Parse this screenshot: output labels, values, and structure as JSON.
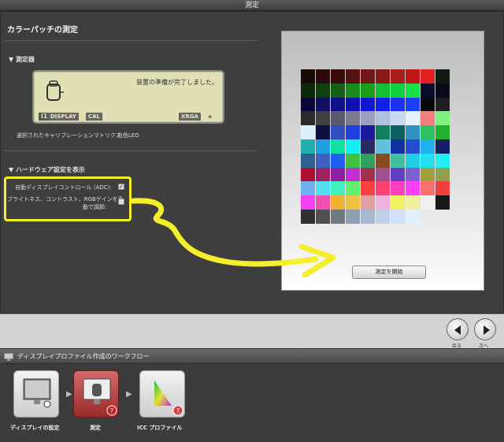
{
  "window": {
    "title": "測定"
  },
  "main": {
    "heading": "カラーパッチの測定",
    "instrument": {
      "section_title": "▼ 測定器",
      "lcd_message": "装置の準備が完了しました。",
      "lcd_tags": [
        "i1",
        "DISPLAY",
        "CAL",
        "XRGA"
      ],
      "calibration_label": "選択されたキャリブレーションマトリクス:",
      "calibration_value": "白色LED"
    },
    "hardware": {
      "section_title": "▼ ハードウェア設定を表示",
      "adc_label": "自動ディスプレイコントロール (ADC):",
      "adc_checked": true,
      "rgb_label_1": "ブライトネス、コントラスト、RGBゲインを手",
      "rgb_label_2": "動で調節:",
      "rgb_checked": false
    },
    "start_button": "測定を開始",
    "annotation_color": "#f5ef2b"
  },
  "nav": {
    "back_label": "戻る",
    "next_label": "次へ"
  },
  "workflow": {
    "title": "ディスプレイプロファイル作成のワークフロー",
    "steps": [
      {
        "label": "ディスプレイの設定",
        "icon": "monitor-settings-icon",
        "state": "done"
      },
      {
        "label": "測定",
        "icon": "measure-device-icon",
        "state": "active"
      },
      {
        "label": "ICC プロファイル",
        "icon": "gamut-icon",
        "state": "pending"
      }
    ]
  },
  "patches": {
    "rows": [
      [
        "#1a0a0a",
        "#2a0a0a",
        "#3a0a0a",
        "#551010",
        "#701818",
        "#8a1a1a",
        "#a81c1c",
        "#c01818",
        "#e02020",
        "#101a10"
      ],
      [
        "#0a2a0a",
        "#104010",
        "#156015",
        "#1a8a1a",
        "#18a018",
        "#15c030",
        "#10d040",
        "#18e048",
        "#0a0a2a",
        "#0a0a1a"
      ],
      [
        "#0a0a3a",
        "#101060",
        "#10108a",
        "#1010b0",
        "#1018d0",
        "#1020e8",
        "#1a30f0",
        "#1a40ff",
        "#080808",
        "#202020"
      ],
      [
        "#2a2a2a",
        "#404040",
        "#5a5a6a",
        "#7a7a90",
        "#9aa0c0",
        "#b0c0e0",
        "#c8d8f0",
        "#e8f0fa",
        "#f08080",
        "#80f080"
      ],
      [
        "#d8f0ff",
        "#101040",
        "#3050c0",
        "#2040e0",
        "#1a1aa0",
        "#108060",
        "#0a6060",
        "#3090c0",
        "#30c060",
        "#20b030"
      ],
      [
        "#20b0b0",
        "#20a0e0",
        "#10e0a0",
        "#10f0f0",
        "#2a2a60",
        "#60c0e0",
        "#1030a0",
        "#2050d0",
        "#20b0f0",
        "#102060"
      ],
      [
        "#306090",
        "#4060c0",
        "#2060f0",
        "#40c040",
        "#30a060",
        "#8a4a20",
        "#40c0a0",
        "#20d0e0",
        "#20e0f0",
        "#20f0f0"
      ],
      [
        "#b01030",
        "#a02060",
        "#9020a0",
        "#c030d0",
        "#a03050",
        "#a05090",
        "#6040c0",
        "#8060d0",
        "#a0a040",
        "#90a050"
      ],
      [
        "#70b0f0",
        "#50e0f0",
        "#40f0c0",
        "#60f070",
        "#ff4040",
        "#ff4070",
        "#ff40c0",
        "#ff40ff",
        "#ff7070",
        "#f04040"
      ],
      [
        "#f040f0",
        "#f050b0",
        "#f0b030",
        "#f0c040",
        "#e0a0a0",
        "#f0b0e0",
        "#f0f060",
        "#f0f0a0",
        "#f0f0f0",
        "#181818"
      ],
      [
        "#303030",
        "#505050",
        "#707880",
        "#90a0b0",
        "#a8b8d0",
        "#c0d0e8",
        "#d0e0f8",
        "#e0f0fc"
      ]
    ]
  }
}
